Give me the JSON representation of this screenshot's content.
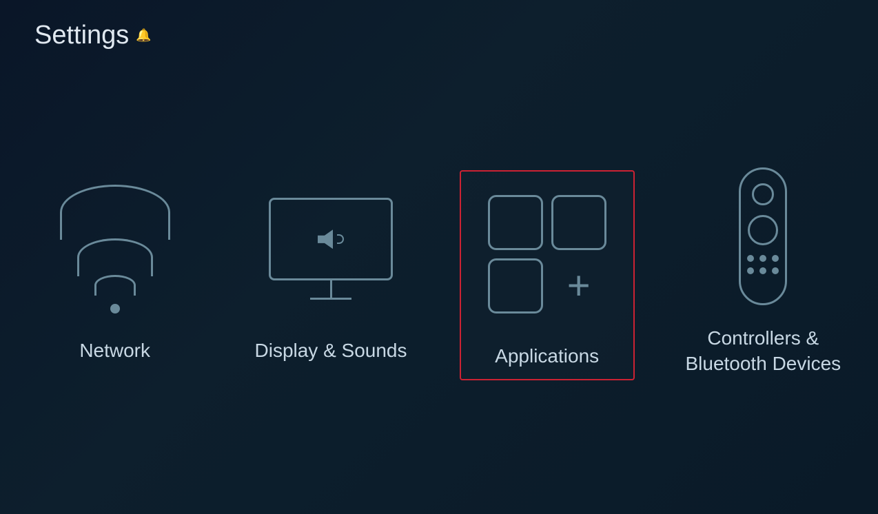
{
  "header": {
    "title": "Settings",
    "bell_label": "🔔"
  },
  "items": [
    {
      "id": "network",
      "label": "Network",
      "active": false
    },
    {
      "id": "display-sounds",
      "label": "Display & Sounds",
      "active": false
    },
    {
      "id": "applications",
      "label": "Applications",
      "active": true
    },
    {
      "id": "controllers",
      "label": "Controllers & Bluetooth Devices",
      "active": false
    }
  ],
  "colors": {
    "accent_border": "#cc2233",
    "icon_stroke": "#6a8a9a",
    "text": "#c8d8e4",
    "bg_dark": "#0a1628"
  }
}
